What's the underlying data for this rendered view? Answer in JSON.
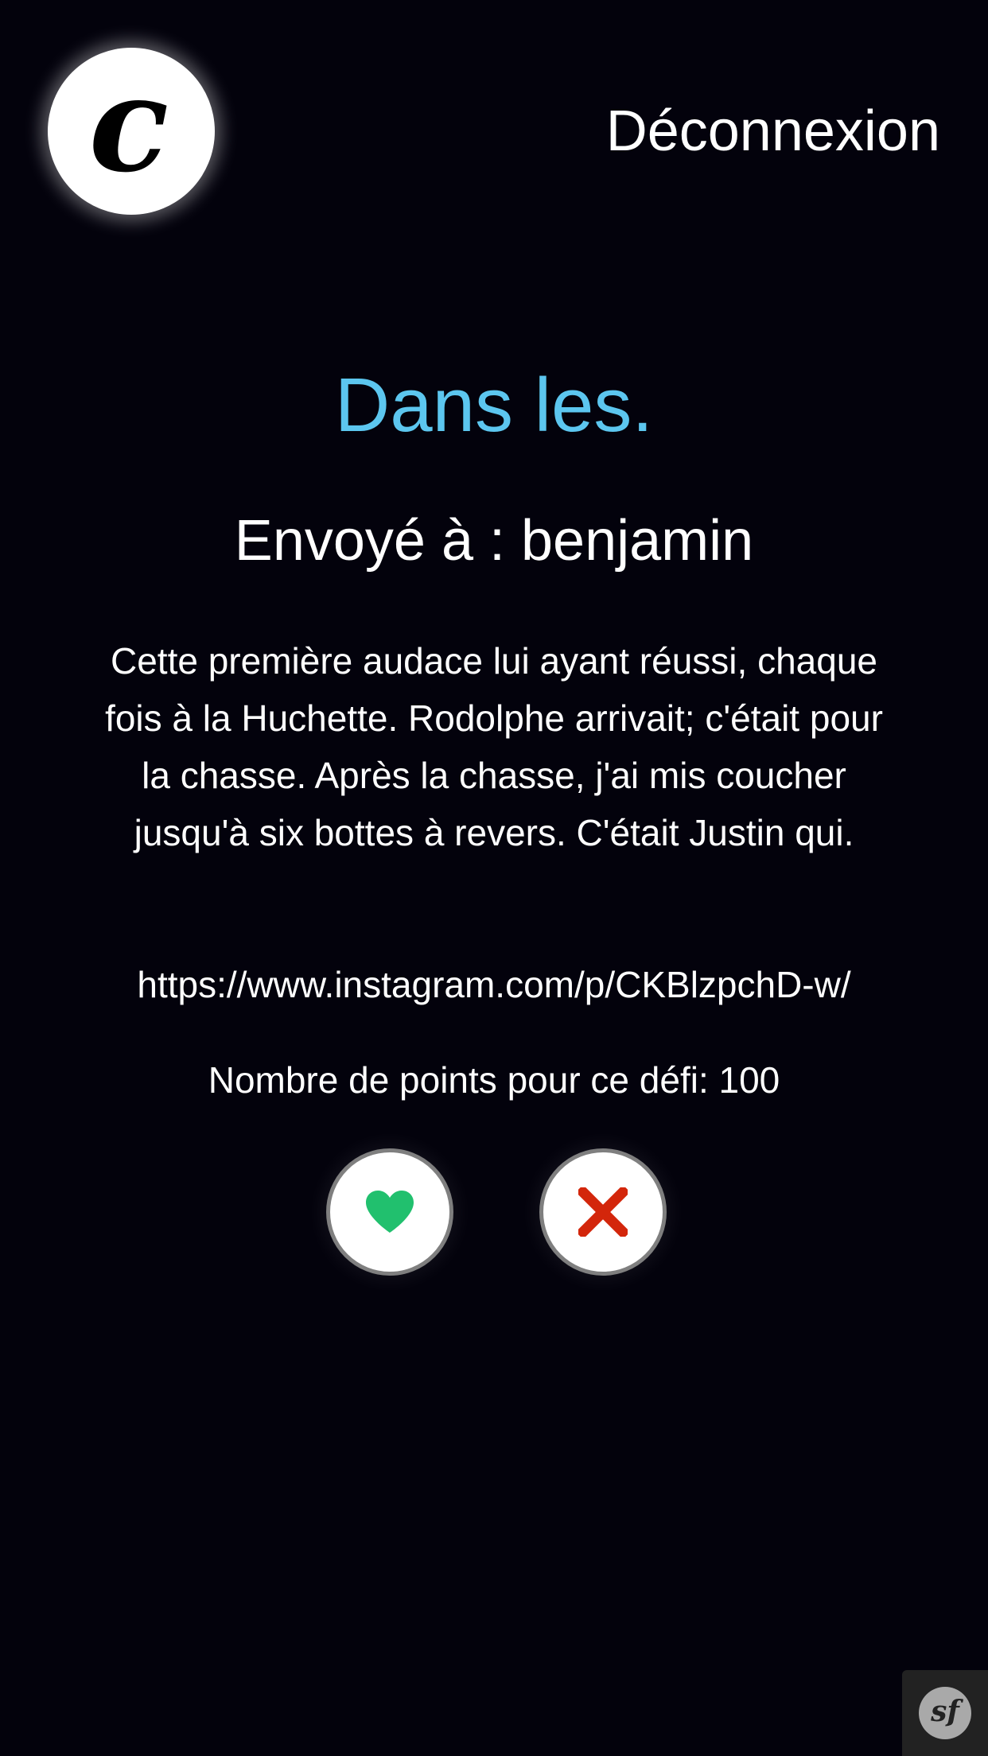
{
  "header": {
    "logo_letter": "c",
    "logout_label": "Déconnexion"
  },
  "challenge": {
    "title": "Dans les.",
    "sent_to": "Envoyé à : benjamin",
    "description": "Cette première audace lui ayant réussi, chaque fois à la Huchette. Rodolphe arrivait; c'était pour la chasse. Après la chasse, j'ai mis coucher jusqu'à six bottes à revers. C'était Justin qui.",
    "link": "https://www.instagram.com/p/CKBlzpchD-w/",
    "points": "Nombre de points pour ce défi: 100"
  },
  "actions": {
    "like_icon": "heart-icon",
    "dismiss_icon": "close-icon",
    "like_color": "#21c06e",
    "dismiss_color": "#d3260b"
  },
  "debug_toolbar": {
    "logo_text": "sf"
  },
  "colors": {
    "background": "#03020c",
    "title": "#5cc6ef",
    "text": "#ffffff"
  }
}
